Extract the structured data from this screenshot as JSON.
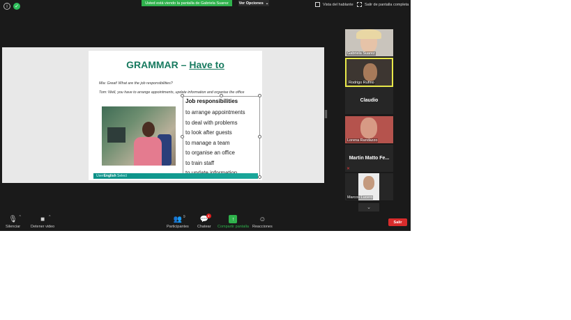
{
  "top_bar": {
    "info_icon": "info-icon",
    "security_icon": "shield-icon",
    "banner_text": "Usted está viendo la pantalla de Gabriela Suarez",
    "view_options_label": "Ver Opciones",
    "speaker_view_label": "Vista del hablante",
    "exit_fullscreen_label": "Salir de pantalla completa"
  },
  "slide": {
    "title_part1": "GRAMMAR –",
    "title_part2": "Have to",
    "dialog_line1": "Mia: Great! What are the job responsibilities?",
    "dialog_line2": "Tom: Well, you have to arrange appointments, update information and organise the office",
    "box_title": "Job responsibilities",
    "responsibilities": [
      "to arrange appointments",
      "to deal with problems",
      "to look after guests",
      "to manage a team",
      "to organise an office",
      "to train staff",
      "to update information"
    ],
    "footer_brand_prefix": "User",
    "footer_brand_bold": "English",
    "footer_brand_suffix": "Select"
  },
  "participants": [
    {
      "name": "Gabriela Suarez",
      "has_video": true
    },
    {
      "name": "Rodrigo Rufino",
      "has_video": true,
      "active_speaker": true
    },
    {
      "name": "Claudio",
      "has_video": false
    },
    {
      "name": "Lorena Randazzo",
      "has_video": true
    },
    {
      "name": "Martin Matto Fe...",
      "has_video": false,
      "muted": true
    },
    {
      "name": "Marcos Lucero",
      "has_video": true
    }
  ],
  "toolbar": {
    "mute_label": "Silenciar",
    "video_label": "Detener video",
    "participants_label": "Participantes",
    "participants_count": "9",
    "chat_label": "Chatear",
    "chat_badge": "4",
    "share_label": "Compartir pantalla",
    "reactions_label": "Reacciones",
    "leave_label": "Salir"
  }
}
